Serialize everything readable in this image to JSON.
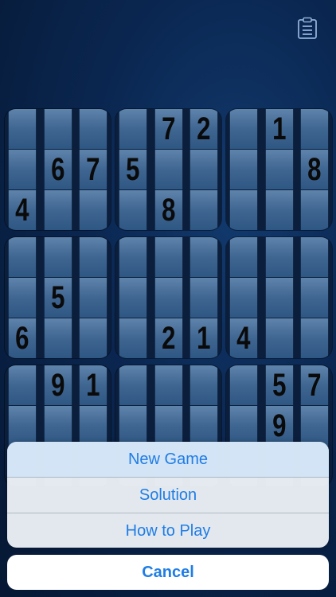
{
  "toolbar": {
    "icon": "clipboard-list-icon"
  },
  "board": {
    "boxes": [
      [
        "",
        "",
        "",
        "",
        "6",
        "7",
        "4",
        "",
        ""
      ],
      [
        "",
        "7",
        "2",
        "5",
        "",
        "",
        "",
        "8",
        ""
      ],
      [
        "",
        "1",
        "",
        "",
        "",
        "8",
        "",
        "",
        ""
      ],
      [
        "",
        "",
        "",
        "",
        "5",
        "",
        "6",
        "",
        ""
      ],
      [
        "",
        "",
        "",
        "",
        "",
        "",
        "",
        "2",
        "1"
      ],
      [
        "",
        "",
        "",
        "",
        "",
        "",
        "4",
        "",
        ""
      ],
      [
        "",
        "9",
        "1",
        "",
        "",
        "",
        "",
        "",
        ""
      ],
      [
        "",
        "",
        "",
        "",
        "",
        "",
        "",
        "",
        ""
      ],
      [
        "",
        "5",
        "7",
        "",
        "9",
        "",
        "",
        "",
        ""
      ]
    ]
  },
  "action_sheet": {
    "items": [
      "New Game",
      "Solution",
      "How to Play"
    ],
    "cancel": "Cancel"
  },
  "colors": {
    "accent": "#1f7de6",
    "cell": "#3f6691",
    "background": "#0a2650"
  }
}
